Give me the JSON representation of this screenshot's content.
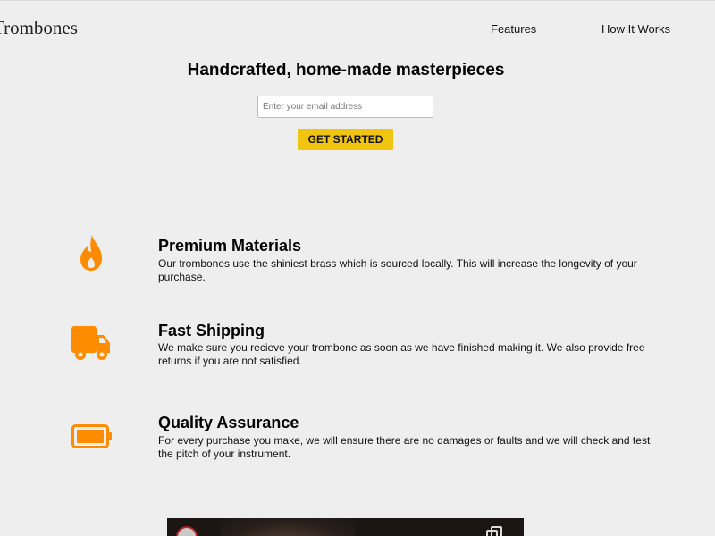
{
  "header": {
    "logo_text": "Trombones",
    "nav": [
      {
        "label": "Features"
      },
      {
        "label": "How It Works"
      }
    ]
  },
  "hero": {
    "title": "Handcrafted, home-made masterpieces",
    "email_placeholder": "Enter your email address",
    "email_value": "",
    "cta_label": "GET STARTED"
  },
  "features": [
    {
      "icon": "flame-icon",
      "title": "Premium Materials",
      "description": "Our trombones use the shiniest brass which is sourced locally. This will increase the longevity of your purchase."
    },
    {
      "icon": "truck-icon",
      "title": "Fast Shipping",
      "description": "We make sure you recieve your trombone as soon as we have finished making it. We also provide free returns if you are not satisfied."
    },
    {
      "icon": "battery-icon",
      "title": "Quality Assurance",
      "description": "For every purchase you make, we will ensure there are no damages or faults and we will check and test the pitch of your instrument."
    }
  ],
  "video": {
    "icons": [
      "channel-avatar",
      "copy-link-icon"
    ]
  },
  "colors": {
    "background": "#eeeeee",
    "accent_icon": "#ff8c00",
    "cta_background": "#f1c40f",
    "text": "#000000"
  }
}
